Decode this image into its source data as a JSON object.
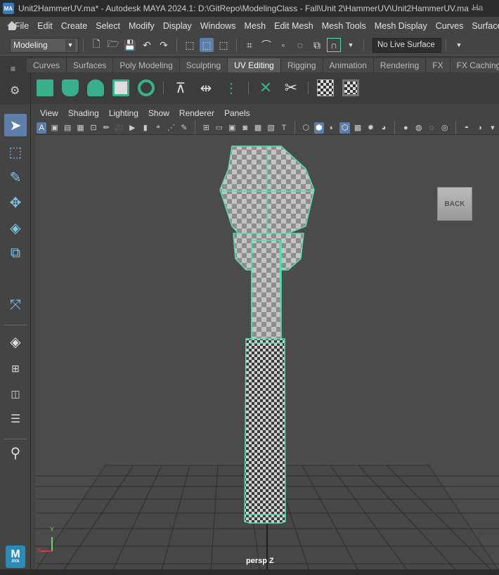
{
  "window": {
    "title": "Unit2HammerUV.ma* - Autodesk MAYA 2024.1: D:\\GitRepo\\ModelingClass - Fall\\Unit 2\\HammerUV\\Unit2HammerUV.ma   ---",
    "title_overflow": "Ha",
    "app_icon_text": "MA"
  },
  "menubar": {
    "items": [
      "File",
      "Edit",
      "Create",
      "Select",
      "Modify",
      "Display",
      "Windows",
      "Mesh",
      "Edit Mesh",
      "Mesh Tools",
      "Mesh Display",
      "Curves",
      "Surfaces"
    ]
  },
  "statusline": {
    "mode": "Modeling",
    "live_surface": "No Live Surface"
  },
  "shelf": {
    "tabs": [
      "Curves",
      "Surfaces",
      "Poly Modeling",
      "Sculpting",
      "UV Editing",
      "Rigging",
      "Animation",
      "Rendering",
      "FX",
      "FX Caching"
    ],
    "active_tab": "UV Editing"
  },
  "viewport": {
    "menu": [
      "View",
      "Shading",
      "Lighting",
      "Show",
      "Renderer",
      "Panels"
    ],
    "back_label": "BACK",
    "camera_label": "persp Z",
    "axis_y": "Y",
    "axis_x": "X"
  },
  "maya_logo": {
    "letter": "M",
    "sub": "AYA"
  },
  "colors": {
    "accent": "#5d7ea8",
    "wireframe": "#4fe0b0",
    "background": "#444444",
    "viewport": "#4b4b4b"
  }
}
